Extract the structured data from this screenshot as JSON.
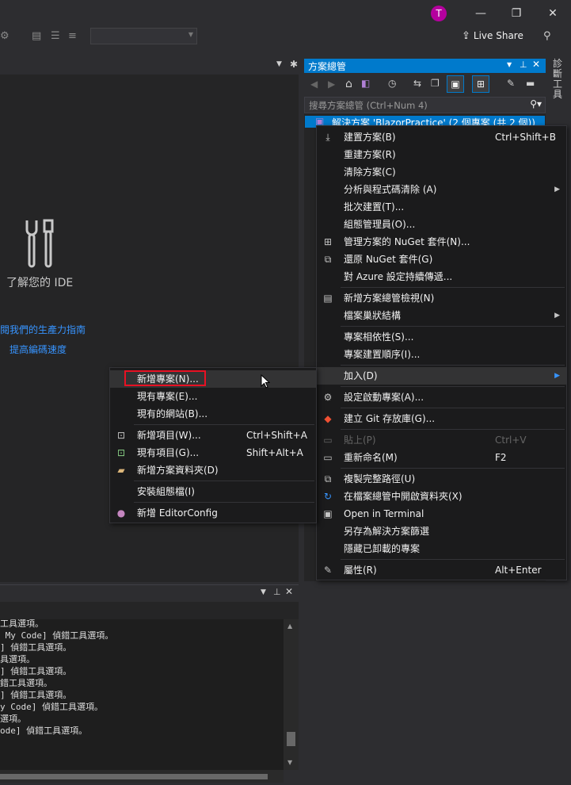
{
  "titlebar": {
    "avatar_letter": "T",
    "minimize": "—",
    "restore": "❐",
    "close": "✕"
  },
  "toolbar": {
    "live_share": "Live Share"
  },
  "editor": {
    "ide_label": "了解您的 IDE",
    "link_productivity": "閱我們的生產力指南",
    "link_speed": "提高編碼速度"
  },
  "output": {
    "lines": [
      "工具選項。",
      " My Code] 偵錯工具選項。",
      "] 偵錯工具選項。",
      "具選項。",
      "] 偵錯工具選項。",
      "錯工具選項。",
      "] 偵錯工具選項。",
      "y Code] 偵錯工具選項。",
      "選項。",
      "ode] 偵錯工具選項。"
    ]
  },
  "solution_explorer": {
    "title": "方案總管",
    "search_placeholder": "搜尋方案總管 (Ctrl+Num 4)",
    "selected_item": "解決方案 'BlazorPractice' (2 個專案 (共 2 個))",
    "side_tab": "診斷工具"
  },
  "context_menu": {
    "items": [
      {
        "label": "建置方案(B)",
        "shortcut": "Ctrl+Shift+B",
        "icon": "build-icon"
      },
      {
        "label": "重建方案(R)"
      },
      {
        "label": "清除方案(C)"
      },
      {
        "label": "分析與程式碼清除 (A)",
        "submenu": true
      },
      {
        "label": "批次建置(T)..."
      },
      {
        "label": "組態管理員(O)..."
      },
      {
        "label": "管理方案的 NuGet 套件(N)...",
        "icon": "nuget-icon"
      },
      {
        "label": "還原 NuGet 套件(G)",
        "icon": "restore-icon"
      },
      {
        "label": "對 Azure 設定持續傳遞..."
      },
      {
        "label": "新增方案總管檢視(N)",
        "icon": "new-view-icon"
      },
      {
        "label": "檔案巢狀結構",
        "submenu": true
      },
      {
        "label": "專案相依性(S)..."
      },
      {
        "label": "專案建置順序(I)..."
      },
      {
        "label": "加入(D)",
        "submenu": true
      },
      {
        "label": "設定啟動專案(A)...",
        "icon": "gear-icon"
      },
      {
        "label": "建立 Git 存放庫(G)...",
        "icon": "git-icon"
      },
      {
        "label": "貼上(P)",
        "shortcut": "Ctrl+V",
        "disabled": true,
        "icon": "paste-icon"
      },
      {
        "label": "重新命名(M)",
        "shortcut": "F2",
        "icon": "rename-icon"
      },
      {
        "label": "複製完整路徑(U)",
        "icon": "copy-icon"
      },
      {
        "label": "在檔案總管中開啟資料夾(X)",
        "icon": "refresh-icon"
      },
      {
        "label": "Open in Terminal",
        "icon": "terminal-icon"
      },
      {
        "label": "另存為解決方案篩選"
      },
      {
        "label": "隱藏已卸載的專案"
      },
      {
        "label": "屬性(R)",
        "shortcut": "Alt+Enter",
        "icon": "wrench-icon"
      }
    ]
  },
  "add_submenu": {
    "items": [
      {
        "label": "新增專案(N)...",
        "highlighted": true
      },
      {
        "label": "現有專案(E)..."
      },
      {
        "label": "現有的網站(B)..."
      },
      {
        "label": "新增項目(W)...",
        "shortcut": "Ctrl+Shift+A",
        "icon": "new-item-icon"
      },
      {
        "label": "現有項目(G)...",
        "shortcut": "Shift+Alt+A",
        "icon": "existing-item-icon"
      },
      {
        "label": "新增方案資料夾(D)",
        "icon": "folder-icon"
      },
      {
        "label": "安裝組態檔(I)"
      },
      {
        "label": "新增 EditorConfig",
        "icon": "lightbulb-icon"
      }
    ]
  }
}
